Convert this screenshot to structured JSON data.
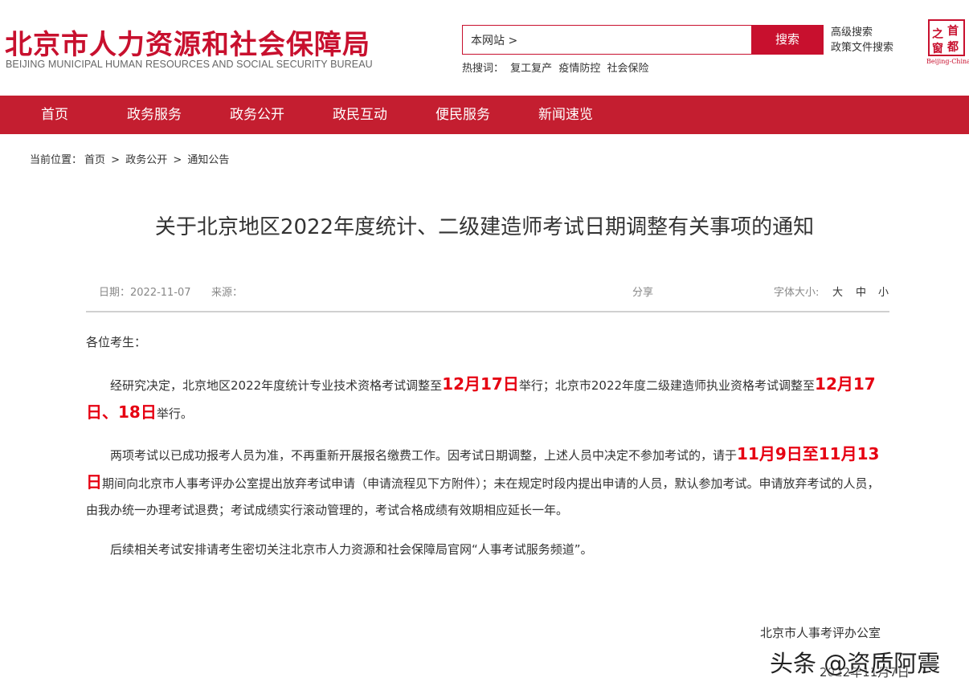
{
  "header": {
    "logo_cn": "北京市人力资源和社会保障局",
    "logo_en": "BEIJING MUNICIPAL HUMAN RESOURCES AND SOCIAL SECURITY BUREAU",
    "search": {
      "value": "本网站 >",
      "button": "搜索"
    },
    "advanced_search": "高级搜索",
    "policy_search": "政策文件搜索",
    "hot_label": "热搜词：",
    "hot_terms": [
      "复工复产",
      "疫情防控",
      "社会保险"
    ],
    "capital_logo": {
      "chars": [
        "首",
        "都",
        "之",
        "窗"
      ],
      "en": "Beijing-China"
    }
  },
  "nav": {
    "items": [
      "首页",
      "政务服务",
      "政务公开",
      "政民互动",
      "便民服务",
      "新闻速览"
    ]
  },
  "breadcrumb": {
    "prefix": "当前位置：",
    "items": [
      "首页",
      "政务公开",
      "通知公告"
    ],
    "separator": ">"
  },
  "article": {
    "title": "关于北京地区2022年度统计、二级建造师考试日期调整有关事项的通知",
    "date": "日期：2022-11-07",
    "source": "来源：",
    "share": "分享",
    "font_size_label": "字体大小:",
    "font_sizes": [
      "大",
      "中",
      "小"
    ],
    "greeting": "各位考生：",
    "p1": {
      "t1": "经研究决定，北京地区2022年度统计专业技术资格考试调整至",
      "h1": "12月17日",
      "t2": "举行；北京市2022年度二级建造师执业资格考试调整至",
      "h2": "12月17日、18日",
      "t3": "举行。"
    },
    "p2": {
      "t1": "两项考试以已成功报考人员为准，不再重新开展报名缴费工作。因考试日期调整，上述人员中决定不参加考试的，请于",
      "h1": "11月9日至11月13日",
      "t2": "期间向北京市人事考评办公室提出放弃考试申请（申请流程见下方附件）；未在规定时段内提出申请的人员，默认参加考试。申请放弃考试的人员，由我办统一办理考试退费；考试成绩实行滚动管理的，考试合格成绩有效期相应延长一年。"
    },
    "p3": "后续相关考试安排请考生密切关注北京市人力资源和社会保障局官网“人事考试服务频道”。",
    "signature": "北京市人事考评办公室",
    "sign_date": "2022年11月7日"
  },
  "watermark": "头条 @资质阿震",
  "colors": {
    "brand_red": "#c41e30",
    "highlight_red": "#e60012"
  }
}
